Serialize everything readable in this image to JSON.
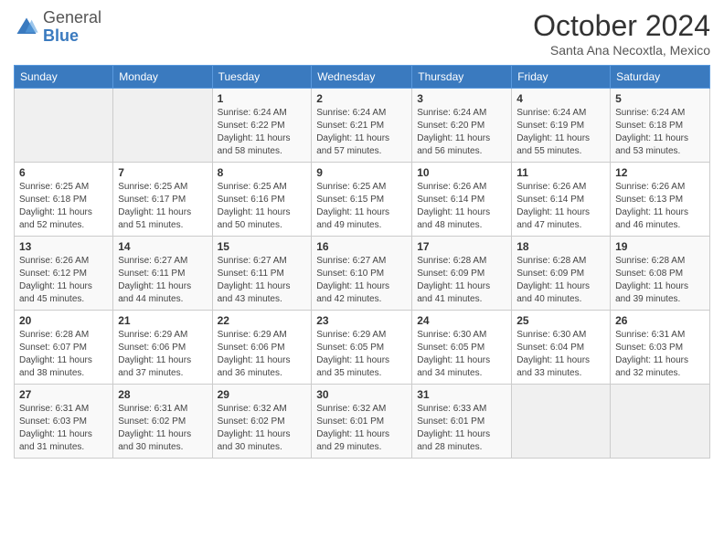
{
  "header": {
    "logo_general": "General",
    "logo_blue": "Blue",
    "month": "October 2024",
    "location": "Santa Ana Necoxtla, Mexico"
  },
  "days_of_week": [
    "Sunday",
    "Monday",
    "Tuesday",
    "Wednesday",
    "Thursday",
    "Friday",
    "Saturday"
  ],
  "weeks": [
    [
      {
        "day": "",
        "info": ""
      },
      {
        "day": "",
        "info": ""
      },
      {
        "day": "1",
        "info": "Sunrise: 6:24 AM\nSunset: 6:22 PM\nDaylight: 11 hours and 58 minutes."
      },
      {
        "day": "2",
        "info": "Sunrise: 6:24 AM\nSunset: 6:21 PM\nDaylight: 11 hours and 57 minutes."
      },
      {
        "day": "3",
        "info": "Sunrise: 6:24 AM\nSunset: 6:20 PM\nDaylight: 11 hours and 56 minutes."
      },
      {
        "day": "4",
        "info": "Sunrise: 6:24 AM\nSunset: 6:19 PM\nDaylight: 11 hours and 55 minutes."
      },
      {
        "day": "5",
        "info": "Sunrise: 6:24 AM\nSunset: 6:18 PM\nDaylight: 11 hours and 53 minutes."
      }
    ],
    [
      {
        "day": "6",
        "info": "Sunrise: 6:25 AM\nSunset: 6:18 PM\nDaylight: 11 hours and 52 minutes."
      },
      {
        "day": "7",
        "info": "Sunrise: 6:25 AM\nSunset: 6:17 PM\nDaylight: 11 hours and 51 minutes."
      },
      {
        "day": "8",
        "info": "Sunrise: 6:25 AM\nSunset: 6:16 PM\nDaylight: 11 hours and 50 minutes."
      },
      {
        "day": "9",
        "info": "Sunrise: 6:25 AM\nSunset: 6:15 PM\nDaylight: 11 hours and 49 minutes."
      },
      {
        "day": "10",
        "info": "Sunrise: 6:26 AM\nSunset: 6:14 PM\nDaylight: 11 hours and 48 minutes."
      },
      {
        "day": "11",
        "info": "Sunrise: 6:26 AM\nSunset: 6:14 PM\nDaylight: 11 hours and 47 minutes."
      },
      {
        "day": "12",
        "info": "Sunrise: 6:26 AM\nSunset: 6:13 PM\nDaylight: 11 hours and 46 minutes."
      }
    ],
    [
      {
        "day": "13",
        "info": "Sunrise: 6:26 AM\nSunset: 6:12 PM\nDaylight: 11 hours and 45 minutes."
      },
      {
        "day": "14",
        "info": "Sunrise: 6:27 AM\nSunset: 6:11 PM\nDaylight: 11 hours and 44 minutes."
      },
      {
        "day": "15",
        "info": "Sunrise: 6:27 AM\nSunset: 6:11 PM\nDaylight: 11 hours and 43 minutes."
      },
      {
        "day": "16",
        "info": "Sunrise: 6:27 AM\nSunset: 6:10 PM\nDaylight: 11 hours and 42 minutes."
      },
      {
        "day": "17",
        "info": "Sunrise: 6:28 AM\nSunset: 6:09 PM\nDaylight: 11 hours and 41 minutes."
      },
      {
        "day": "18",
        "info": "Sunrise: 6:28 AM\nSunset: 6:09 PM\nDaylight: 11 hours and 40 minutes."
      },
      {
        "day": "19",
        "info": "Sunrise: 6:28 AM\nSunset: 6:08 PM\nDaylight: 11 hours and 39 minutes."
      }
    ],
    [
      {
        "day": "20",
        "info": "Sunrise: 6:28 AM\nSunset: 6:07 PM\nDaylight: 11 hours and 38 minutes."
      },
      {
        "day": "21",
        "info": "Sunrise: 6:29 AM\nSunset: 6:06 PM\nDaylight: 11 hours and 37 minutes."
      },
      {
        "day": "22",
        "info": "Sunrise: 6:29 AM\nSunset: 6:06 PM\nDaylight: 11 hours and 36 minutes."
      },
      {
        "day": "23",
        "info": "Sunrise: 6:29 AM\nSunset: 6:05 PM\nDaylight: 11 hours and 35 minutes."
      },
      {
        "day": "24",
        "info": "Sunrise: 6:30 AM\nSunset: 6:05 PM\nDaylight: 11 hours and 34 minutes."
      },
      {
        "day": "25",
        "info": "Sunrise: 6:30 AM\nSunset: 6:04 PM\nDaylight: 11 hours and 33 minutes."
      },
      {
        "day": "26",
        "info": "Sunrise: 6:31 AM\nSunset: 6:03 PM\nDaylight: 11 hours and 32 minutes."
      }
    ],
    [
      {
        "day": "27",
        "info": "Sunrise: 6:31 AM\nSunset: 6:03 PM\nDaylight: 11 hours and 31 minutes."
      },
      {
        "day": "28",
        "info": "Sunrise: 6:31 AM\nSunset: 6:02 PM\nDaylight: 11 hours and 30 minutes."
      },
      {
        "day": "29",
        "info": "Sunrise: 6:32 AM\nSunset: 6:02 PM\nDaylight: 11 hours and 30 minutes."
      },
      {
        "day": "30",
        "info": "Sunrise: 6:32 AM\nSunset: 6:01 PM\nDaylight: 11 hours and 29 minutes."
      },
      {
        "day": "31",
        "info": "Sunrise: 6:33 AM\nSunset: 6:01 PM\nDaylight: 11 hours and 28 minutes."
      },
      {
        "day": "",
        "info": ""
      },
      {
        "day": "",
        "info": ""
      }
    ]
  ]
}
